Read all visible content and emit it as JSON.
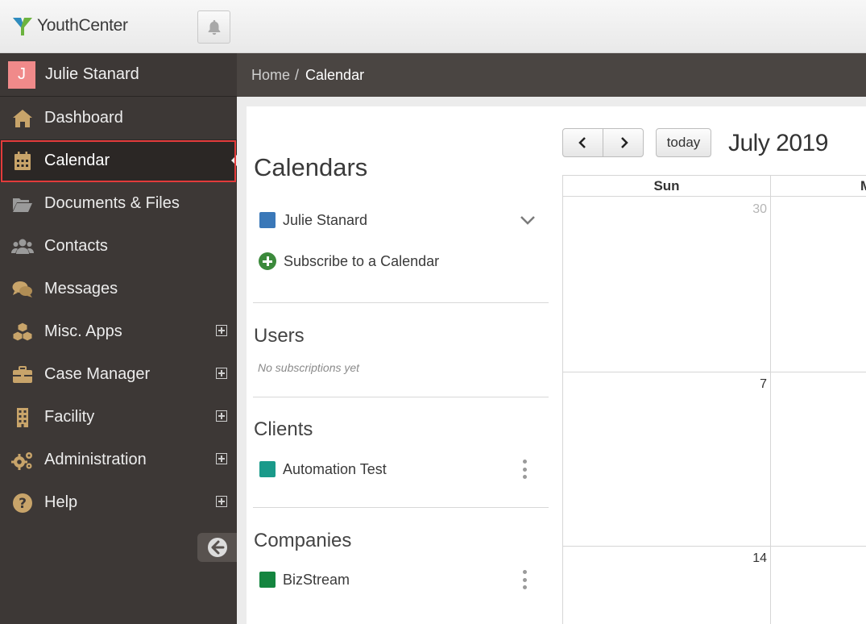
{
  "app": {
    "logo_text": "YouthCenter",
    "logo_icon": "youthcenter-logo-icon",
    "notifications_icon": "bell-icon"
  },
  "user": {
    "initial": "J",
    "name": "Julie Stanard",
    "avatar_color": "#f08a8a"
  },
  "sidebar": {
    "items": [
      {
        "label": "Dashboard",
        "icon": "home-icon",
        "expandable": false,
        "active": false
      },
      {
        "label": "Calendar",
        "icon": "calendar-icon",
        "expandable": false,
        "active": true
      },
      {
        "label": "Documents & Files",
        "icon": "folder-open-icon",
        "expandable": false,
        "active": false
      },
      {
        "label": "Contacts",
        "icon": "users-icon",
        "expandable": false,
        "active": false
      },
      {
        "label": "Messages",
        "icon": "comments-icon",
        "expandable": false,
        "active": false
      },
      {
        "label": "Misc. Apps",
        "icon": "cubes-icon",
        "expandable": true,
        "active": false
      },
      {
        "label": "Case Manager",
        "icon": "briefcase-icon",
        "expandable": true,
        "active": false
      },
      {
        "label": "Facility",
        "icon": "building-icon",
        "expandable": true,
        "active": false
      },
      {
        "label": "Administration",
        "icon": "cogs-icon",
        "expandable": true,
        "active": false
      },
      {
        "label": "Help",
        "icon": "question-circle-icon",
        "expandable": true,
        "active": false
      }
    ],
    "collapse_icon": "arrow-left-circle-icon"
  },
  "breadcrumb": {
    "home": "Home",
    "separator": "/",
    "current": "Calendar"
  },
  "calendars_panel": {
    "heading": "Calendars",
    "own": {
      "name": "Julie Stanard",
      "color": "#3a78b8"
    },
    "subscribe_label": "Subscribe to a Calendar",
    "users": {
      "title": "Users",
      "empty": "No subscriptions yet"
    },
    "clients": {
      "title": "Clients",
      "items": [
        {
          "name": "Automation Test",
          "color": "#1a9a8a"
        }
      ]
    },
    "companies": {
      "title": "Companies",
      "items": [
        {
          "name": "BizStream",
          "color": "#14853f"
        }
      ]
    }
  },
  "calendar": {
    "prev_icon": "chevron-left-icon",
    "next_icon": "chevron-right-icon",
    "today_label": "today",
    "month_title": "July 2019",
    "day_headers": [
      "Sun",
      "Mon"
    ],
    "weeks": [
      {
        "days": [
          "30"
        ],
        "other_month": [
          true
        ]
      },
      {
        "days": [
          "7"
        ],
        "other_month": [
          false
        ]
      },
      {
        "days": [
          "14"
        ],
        "other_month": [
          false
        ]
      }
    ]
  },
  "colors": {
    "sidebar_bg": "#3d3836",
    "breadcrumb_bg": "#4a4542",
    "active_outline": "#e23b3b",
    "icon_gold": "#c8a46a"
  }
}
